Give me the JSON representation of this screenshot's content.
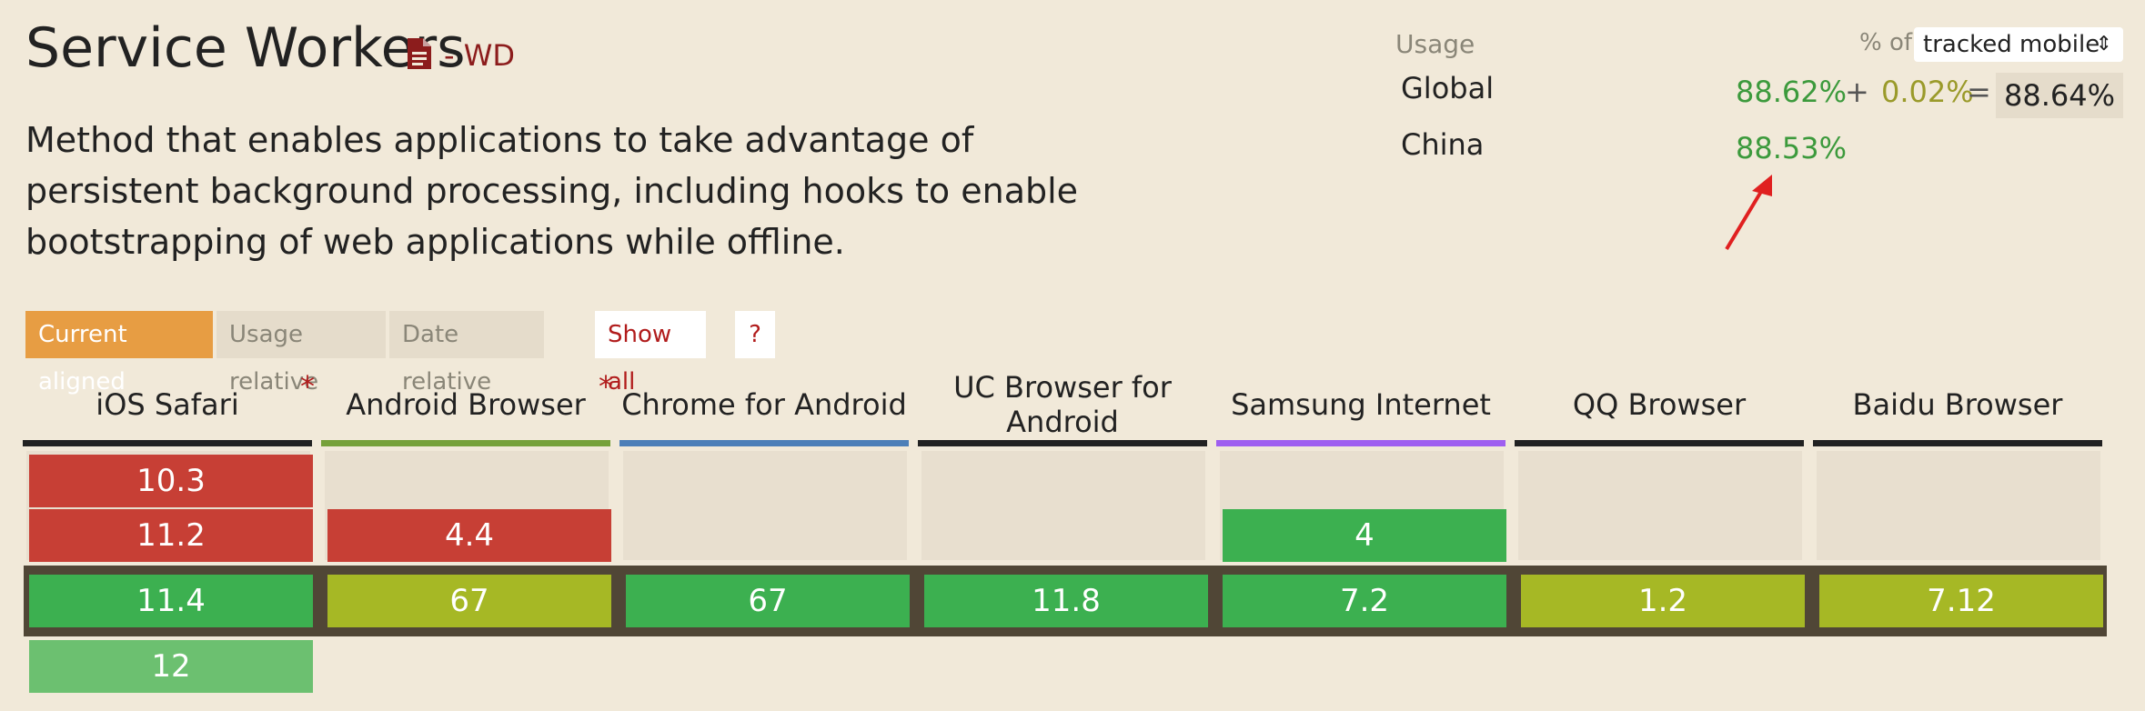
{
  "feature": {
    "title": "Service Workers",
    "status": "- WD",
    "description": "Method that enables applications to take advantage of persistent background processing, including hooks to enable bootstrapping of web applications while offline."
  },
  "usage": {
    "label": "Usage",
    "pct_of_label": "% of",
    "tracked_select": "tracked mobile",
    "global": {
      "label": "Global",
      "full": "88.62%",
      "plus": "+",
      "partial": "0.02%",
      "equals": "=",
      "total": "88.64%"
    },
    "china": {
      "label": "China",
      "full": "88.53%"
    }
  },
  "view_buttons": {
    "current": "Current aligned",
    "usage_relative": "Usage relative",
    "date_relative": "Date relative",
    "show_all": "Show all",
    "help": "?"
  },
  "asterisk": "*",
  "colors": {
    "supported": "#3cb050",
    "partial": "#a6b825",
    "unsupported": "#c73f35",
    "future": "#6cc070",
    "status_red": "#8c1c1c",
    "accent_orange": "#e79d43"
  },
  "browsers": [
    {
      "name": "iOS Safari",
      "bar_color": "#222222",
      "asterisk": true,
      "above": [
        {
          "version": "10.3",
          "support": "unsupported"
        },
        {
          "version": "11.2",
          "support": "unsupported"
        }
      ],
      "current": {
        "version": "11.4",
        "support": "supported"
      },
      "below": [
        {
          "version": "12",
          "support": "future"
        }
      ]
    },
    {
      "name": "Android Browser",
      "bar_color": "#76a13a",
      "asterisk": true,
      "above": [
        {
          "version": "",
          "support": "empty"
        },
        {
          "version": "4.4",
          "support": "unsupported"
        }
      ],
      "current": {
        "version": "67",
        "support": "partial"
      },
      "below": []
    },
    {
      "name": "Chrome for Android",
      "bar_color": "#4d7fb8",
      "asterisk": false,
      "above": [
        {
          "version": "",
          "support": "empty"
        },
        {
          "version": "",
          "support": "empty"
        }
      ],
      "current": {
        "version": "67",
        "support": "supported"
      },
      "below": []
    },
    {
      "name": "UC Browser for Android",
      "bar_color": "#222222",
      "asterisk": false,
      "above": [
        {
          "version": "",
          "support": "empty"
        },
        {
          "version": "",
          "support": "empty"
        }
      ],
      "current": {
        "version": "11.8",
        "support": "supported"
      },
      "below": []
    },
    {
      "name": "Samsung Internet",
      "bar_color": "#9f5ff0",
      "asterisk": false,
      "above": [
        {
          "version": "",
          "support": "empty"
        },
        {
          "version": "4",
          "support": "supported"
        }
      ],
      "current": {
        "version": "7.2",
        "support": "supported"
      },
      "below": []
    },
    {
      "name": "QQ Browser",
      "bar_color": "#222222",
      "asterisk": false,
      "above": [
        {
          "version": "",
          "support": "empty"
        },
        {
          "version": "",
          "support": "empty"
        }
      ],
      "current": {
        "version": "1.2",
        "support": "partial"
      },
      "below": []
    },
    {
      "name": "Baidu Browser",
      "bar_color": "#222222",
      "asterisk": false,
      "above": [
        {
          "version": "",
          "support": "empty"
        },
        {
          "version": "",
          "support": "empty"
        }
      ],
      "current": {
        "version": "7.12",
        "support": "partial"
      },
      "below": []
    }
  ]
}
